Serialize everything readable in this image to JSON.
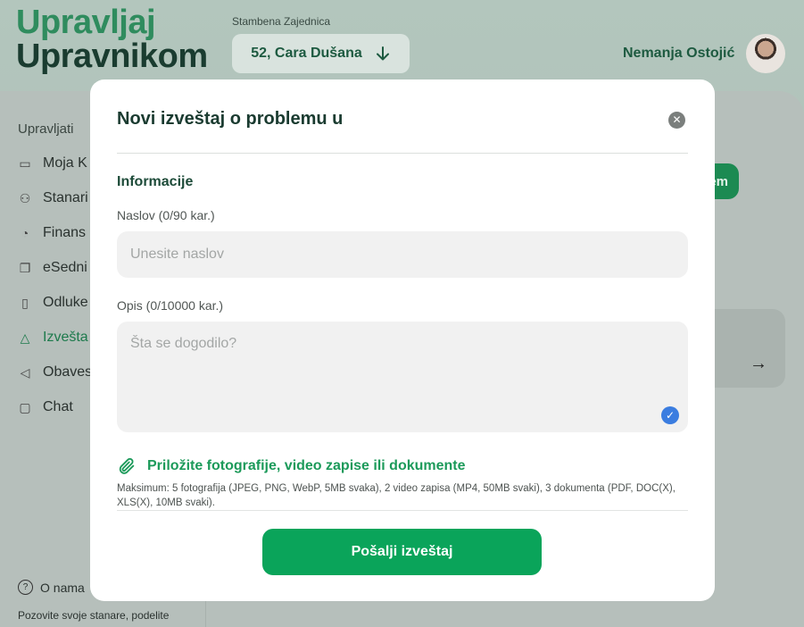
{
  "app": {
    "logo_line1": "Upravljaj",
    "logo_line2": "Upravnikom",
    "community_label": "Stambena Zajednica",
    "community_value": "52, Cara Dušana",
    "user_name": "Nemanja Ostojić"
  },
  "sidebar": {
    "title": "Upravljati",
    "items": [
      {
        "label": "Moja K",
        "icon": "card-icon"
      },
      {
        "label": "Stanari",
        "icon": "users-icon"
      },
      {
        "label": "Finans",
        "icon": "chart-pie-icon"
      },
      {
        "label": "eSedni",
        "icon": "copy-icon"
      },
      {
        "label": "Odluke",
        "icon": "document-icon"
      },
      {
        "label": "Izvešta",
        "icon": "warning-icon"
      },
      {
        "label": "Obaves",
        "icon": "megaphone-icon"
      },
      {
        "label": "Chat",
        "icon": "chat-icon"
      }
    ],
    "about": "O nama",
    "about_sub": "Pozovite svoje stanare, podelite"
  },
  "background": {
    "green_button_partial": "em"
  },
  "modal": {
    "title": "Novi izveštaj o problemu u",
    "section": "Informacije",
    "title_label": "Naslov (0/90 kar.)",
    "title_placeholder": "Unesite naslov",
    "desc_label": "Opis (0/10000 kar.)",
    "desc_placeholder": "Šta se dogodilo?",
    "attach_label": "Priložite fotografije, video zapise ili dokumente",
    "attach_hint": "Maksimum: 5 fotografija (JPEG, PNG, WebP, 5MB svaka), 2 video zapisa (MP4, 50MB svaki), 3 dokumenta (PDF, DOC(X), XLS(X), 10MB svaki).",
    "submit_label": "Pošalji izveštaj"
  },
  "colors": {
    "accent": "#0aa45a",
    "brand_dark": "#1a3b30",
    "check": "#3b7de0"
  }
}
